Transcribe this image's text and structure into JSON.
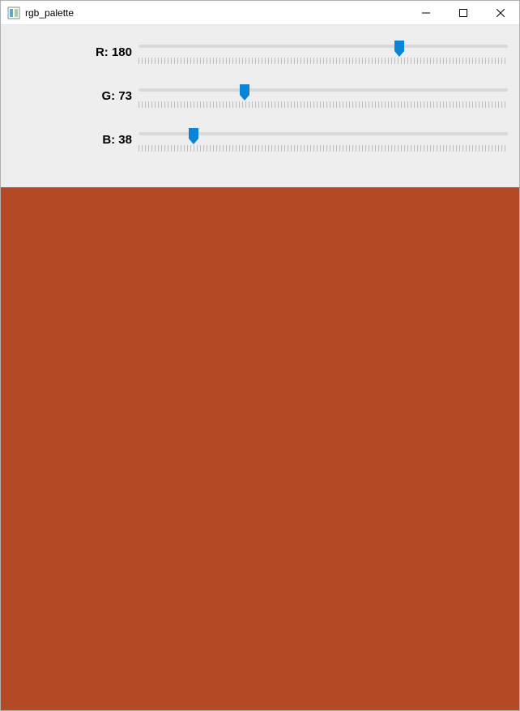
{
  "window": {
    "title": "rgb_palette"
  },
  "sliders": {
    "r": {
      "label": "R: 180",
      "value": 180,
      "min": 0,
      "max": 255
    },
    "g": {
      "label": "G: 73",
      "value": 73,
      "min": 0,
      "max": 255
    },
    "b": {
      "label": "B: 38",
      "value": 38,
      "min": 0,
      "max": 255
    }
  },
  "colors": {
    "swatch": "#b44926",
    "thumb": "#0a84d6",
    "panel_bg": "#eeeeee"
  }
}
